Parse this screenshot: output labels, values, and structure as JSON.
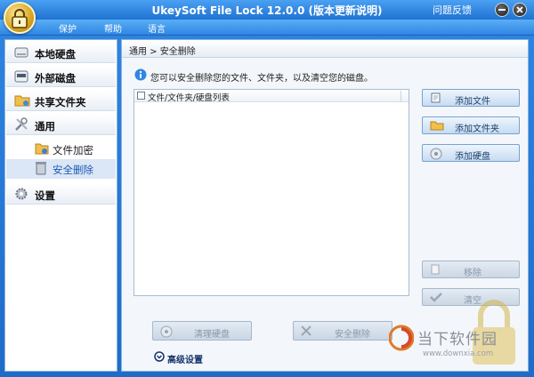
{
  "window": {
    "title": "UkeySoft File Lock 12.0.0 (版本更新说明)",
    "feedback": "问题反馈"
  },
  "menu": [
    {
      "label": "保护"
    },
    {
      "label": "帮助"
    },
    {
      "label": "语言"
    }
  ],
  "sidebar": {
    "items": [
      {
        "label": "本地硬盘",
        "icon": "hard-drive-icon"
      },
      {
        "label": "外部磁盘",
        "icon": "usb-drive-icon"
      },
      {
        "label": "共享文件夹",
        "icon": "shared-folder-icon"
      },
      {
        "label": "通用",
        "icon": "tools-icon"
      },
      {
        "label": "设置",
        "icon": "gear-icon"
      }
    ],
    "subitems": [
      {
        "label": "文件加密",
        "icon": "folder-lock-icon"
      },
      {
        "label": "安全删除",
        "icon": "trash-icon",
        "active": true
      }
    ]
  },
  "main": {
    "breadcrumb": "通用 > 安全删除",
    "info": "您可以安全删除您的文件、文件夹，以及清空您的磁盘。",
    "list_header": "文件/文件夹/硬盘列表",
    "buttons": {
      "add_file": "添加文件",
      "add_folder": "添加文件夹",
      "add_disk": "添加硬盘",
      "remove": "移除",
      "clear": "清空"
    },
    "bottom": {
      "clean_disk": "清理硬盘",
      "secure_delete": "安全删除",
      "advanced": "高级设置"
    }
  },
  "watermark": {
    "text": "当下软件园",
    "url": "www.downxia.com"
  },
  "colors": {
    "accent": "#2f86e3",
    "panel": "#f3f6fa",
    "border": "#8bb3e0"
  }
}
